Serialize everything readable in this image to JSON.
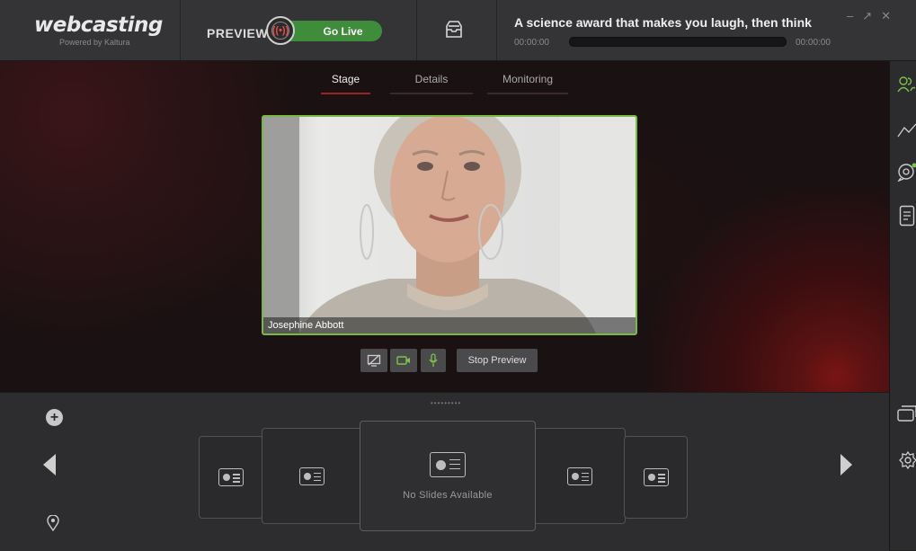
{
  "header": {
    "brand": "webcasting",
    "brand_sub": "Powered by Kaltura",
    "preview_label": "PREVIEW",
    "go_live_label": "Go Live",
    "title": "A science award that makes you laugh, then think",
    "time_start": "00:00:00",
    "time_end": "00:00:00",
    "progress": 0
  },
  "tabs": [
    {
      "label": "Stage",
      "active": true
    },
    {
      "label": "Details",
      "active": false
    },
    {
      "label": "Monitoring",
      "active": false
    }
  ],
  "video": {
    "speaker_name": "Josephine Abbott"
  },
  "controls": {
    "stop_preview_label": "Stop Preview"
  },
  "slides": {
    "empty_label": "No Slides Available"
  },
  "colors": {
    "accent_green": "#3f8c3a",
    "tab_active_underline": "#9b2323",
    "video_border": "#79b844"
  },
  "icons": {
    "rail": [
      "participants-icon",
      "analytics-icon",
      "chat-icon",
      "notes-icon",
      "layout-icon",
      "settings-icon"
    ]
  }
}
